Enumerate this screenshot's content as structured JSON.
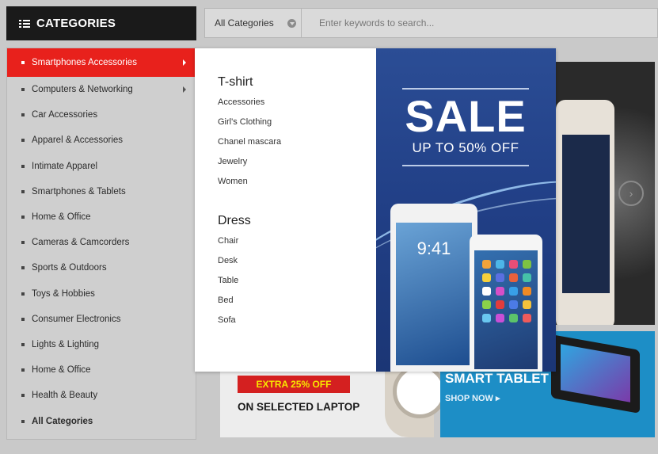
{
  "header": {
    "categories_label": "CATEGORIES",
    "search_category": "All Categories",
    "search_placeholder": "Enter keywords to search..."
  },
  "sidebar": {
    "items": [
      {
        "label": "Smartphones Accessories",
        "active": true,
        "has_sub": true
      },
      {
        "label": "Computers & Networking",
        "active": false,
        "has_sub": true
      },
      {
        "label": "Car Accessories",
        "active": false,
        "has_sub": false
      },
      {
        "label": "Apparel & Accessories",
        "active": false,
        "has_sub": false
      },
      {
        "label": "Intimate Apparel",
        "active": false,
        "has_sub": false
      },
      {
        "label": "Smartphones & Tablets",
        "active": false,
        "has_sub": false
      },
      {
        "label": "Home & Office",
        "active": false,
        "has_sub": false
      },
      {
        "label": "Cameras & Camcorders",
        "active": false,
        "has_sub": false
      },
      {
        "label": "Sports & Outdoors",
        "active": false,
        "has_sub": false
      },
      {
        "label": "Toys & Hobbies",
        "active": false,
        "has_sub": false
      },
      {
        "label": "Consumer Electronics",
        "active": false,
        "has_sub": false
      },
      {
        "label": "Lights & Lighting",
        "active": false,
        "has_sub": false
      },
      {
        "label": "Home & Office",
        "active": false,
        "has_sub": false
      },
      {
        "label": "Health & Beauty",
        "active": false,
        "has_sub": false
      },
      {
        "label": "All Categories",
        "active": false,
        "has_sub": false
      }
    ]
  },
  "dropdown": {
    "groups": [
      {
        "title": "T-shirt",
        "links": [
          "Accessories",
          "Girl's Clothing",
          "Chanel mascara",
          "Jewelry",
          "Women"
        ]
      },
      {
        "title": "Dress",
        "links": [
          "Chair",
          "Desk",
          "Table",
          "Bed",
          "Sofa"
        ]
      }
    ],
    "promo": {
      "headline": "SALE",
      "subline": "UP TO 50% OFF",
      "time": "9:41"
    }
  },
  "banners": {
    "laptop": {
      "deal": "EXTRA 25% OFF",
      "tagline": "ON SELECTED LAPTOP"
    },
    "tablet": {
      "title": "SMART TABLET",
      "cta": "SHOP NOW"
    }
  },
  "colors": {
    "accent": "#e8211c",
    "header_bg": "#1a1a1a",
    "promo_bg": "#2b4d95",
    "tablet_banner": "#1d8ec6",
    "deal_text": "#f7e600"
  },
  "icons": {
    "categories": "list-icon",
    "search_dropdown": "chevron-down-icon",
    "carousel_next": "chevron-right-icon",
    "submenu": "caret-right-icon"
  }
}
